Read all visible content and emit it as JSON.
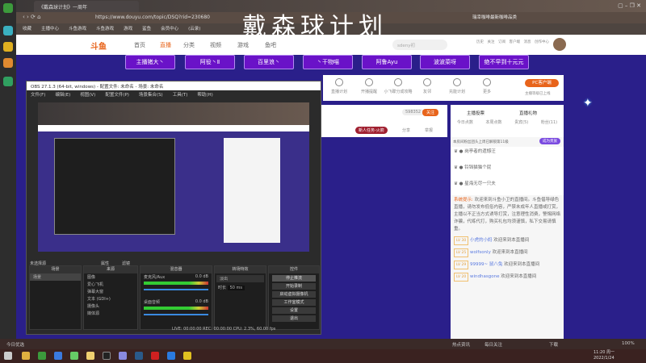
{
  "browser": {
    "tab_title": "《戴森球计划》一周年",
    "url": "https://www.douyu.com/topic/DSQ?rid=230680",
    "search_placeholder": "瑞幸咖啡最新咖啡品类",
    "overlay_title": "戴森球计划",
    "bookmarks": [
      "收藏",
      "主播中心",
      "斗鱼游戏",
      "斗鱼游戏",
      "游戏",
      "鲨鱼",
      "会员中心",
      "(云录)"
    ]
  },
  "site": {
    "logo": "斗鱼",
    "nav": [
      "首页",
      "直播",
      "分类",
      "视频",
      "游戏",
      "鱼吧"
    ],
    "search_placeholder": "sdeny初",
    "header_icons": [
      "历史",
      "关注",
      "订阅",
      "客户端",
      "消息",
      "创作中心"
    ],
    "anchor_pills": [
      "主播猪大丶",
      "阿役丶Ⅱ",
      "百里浪丶",
      "丶干物喵",
      "阿鲁Ayu",
      "波波菜呀",
      "绝不早到十元元"
    ],
    "tools": [
      "直播计划",
      "开播提醒",
      "小飞碟分成攻略",
      "友邻",
      "充能计划",
      "更多"
    ],
    "pc_button": "PC客户端",
    "pc_sub": "主播等级已上线",
    "follow_count": "598352",
    "follow": "关注",
    "task": "新人任务-火箭",
    "share": "分享",
    "report": "举报"
  },
  "chat": {
    "rank": "主播投票",
    "gift_rank": "直播礼物",
    "tabs": [
      "今日点数",
      "本周点数",
      "贵宾(5)",
      "粉丝(11)"
    ],
    "notice": "本房间粉丝团头上周已解锁第11级",
    "join": "成为贵族",
    "vips": [
      "岗亭者的遗憾汪",
      "铃铛猫猫个屁",
      "星海无尽一只夫"
    ],
    "system_label": "系统提示:",
    "system_text": "欢迎来到斗鱼小卫的直播间。斗鱼倡导绿色直播，请勿发布低俗内容，严禁未成年人直播或打赏，主播以不正当方式诱导打赏，注意理性消费，警惕网络诈骗，代练代打，购买礼包均须谨慎，私下交易请慎重。",
    "messages": [
      {
        "lv": "LV 30",
        "user": "小虎的小妈",
        "text": "欢迎来到本直播间"
      },
      {
        "lv": "LV 25",
        "user": "wolfsonly",
        "text": "欢迎来到本直播间"
      },
      {
        "lv": "LV 29",
        "user": "99999~ 鼠八兔",
        "text": "欢迎来到本直播间"
      },
      {
        "lv": "LV 20",
        "user": "windhasgone",
        "text": "欢迎来到本直播间"
      }
    ]
  },
  "obs": {
    "title": "OBS 27.1.3 (64-bit, windows) - 配置文件: 未命名 - 场景: 未命名",
    "menu": [
      "文件(F)",
      "编辑(E)",
      "视图(V)",
      "配置文件(P)",
      "场景集合(S)",
      "工具(T)",
      "帮助(H)"
    ],
    "source_bar": "未选择源",
    "props": "属性",
    "filters": "滤镜",
    "docks": {
      "scenes": "场景",
      "sources": "来源",
      "mixer": "混音器",
      "transitions": "转场特效",
      "controls": "控件"
    },
    "scene_items": [
      "场景"
    ],
    "source_items": [
      "图像",
      "爱心飞机",
      "弹幕大窗",
      "文本 (GDI+)",
      "摄像头",
      "媒体源"
    ],
    "mixer": [
      {
        "name": "麦克风/Aux",
        "db": "0.0 dB"
      },
      {
        "name": "桌面音频",
        "db": "0.0 dB"
      }
    ],
    "transition": "淡出",
    "duration_label": "时长",
    "duration": "50 ms",
    "controls": [
      "停止推流",
      "开始录制",
      "启动虚拟摄像机",
      "工作室模式",
      "设置",
      "退出"
    ],
    "status": "LIVE: 00:00:00   REC: 00:00:00   CPU: 2.3%, 60.00 fps"
  },
  "statusbar": {
    "left": "今日优选",
    "items": [
      "热点资讯",
      "每日关注",
      "下载"
    ],
    "zoom": "100%"
  },
  "taskbar": {
    "time": "11:20 周一",
    "date": "2022/1/24"
  }
}
